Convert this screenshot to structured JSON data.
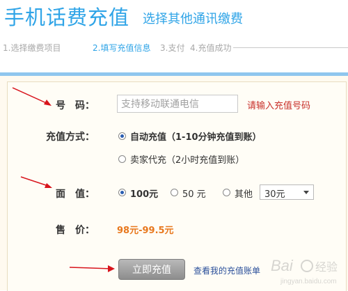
{
  "header": {
    "title": "手机话费充值",
    "subtitle": "选择其他通讯缴费"
  },
  "steps": [
    {
      "label": "1.选择缴费项目",
      "active": false
    },
    {
      "label": "2.填写充值信息",
      "active": true
    },
    {
      "label": "3.支付",
      "active": false
    },
    {
      "label": "4.充值成功",
      "active": false
    }
  ],
  "form": {
    "phone": {
      "label": "号　码：",
      "placeholder": "支持移动联通电信",
      "hint": "请输入充值号码"
    },
    "method": {
      "label": "充值方式：",
      "options": [
        {
          "label": "自动充值（1-10分钟充值到账）",
          "checked": true
        },
        {
          "label": "卖家代充（2小时充值到账）",
          "checked": false
        }
      ]
    },
    "amount": {
      "label": "面　值：",
      "options": [
        {
          "label": "100元",
          "checked": true
        },
        {
          "label": "50 元",
          "checked": false
        },
        {
          "label": "其他",
          "checked": false
        }
      ],
      "other_select_value": "30元"
    },
    "price": {
      "label": "售　价：",
      "value": "98元-99.5元"
    },
    "submit_label": "立即充值",
    "bill_link": "查看我的充值账单"
  },
  "colors": {
    "accent": "#2fa4e7",
    "hint": "#c8302a",
    "price": "#e8781e",
    "link": "#2a4f9a",
    "arrow": "#d8141c"
  },
  "watermark": {
    "text": "Baidu经验"
  }
}
